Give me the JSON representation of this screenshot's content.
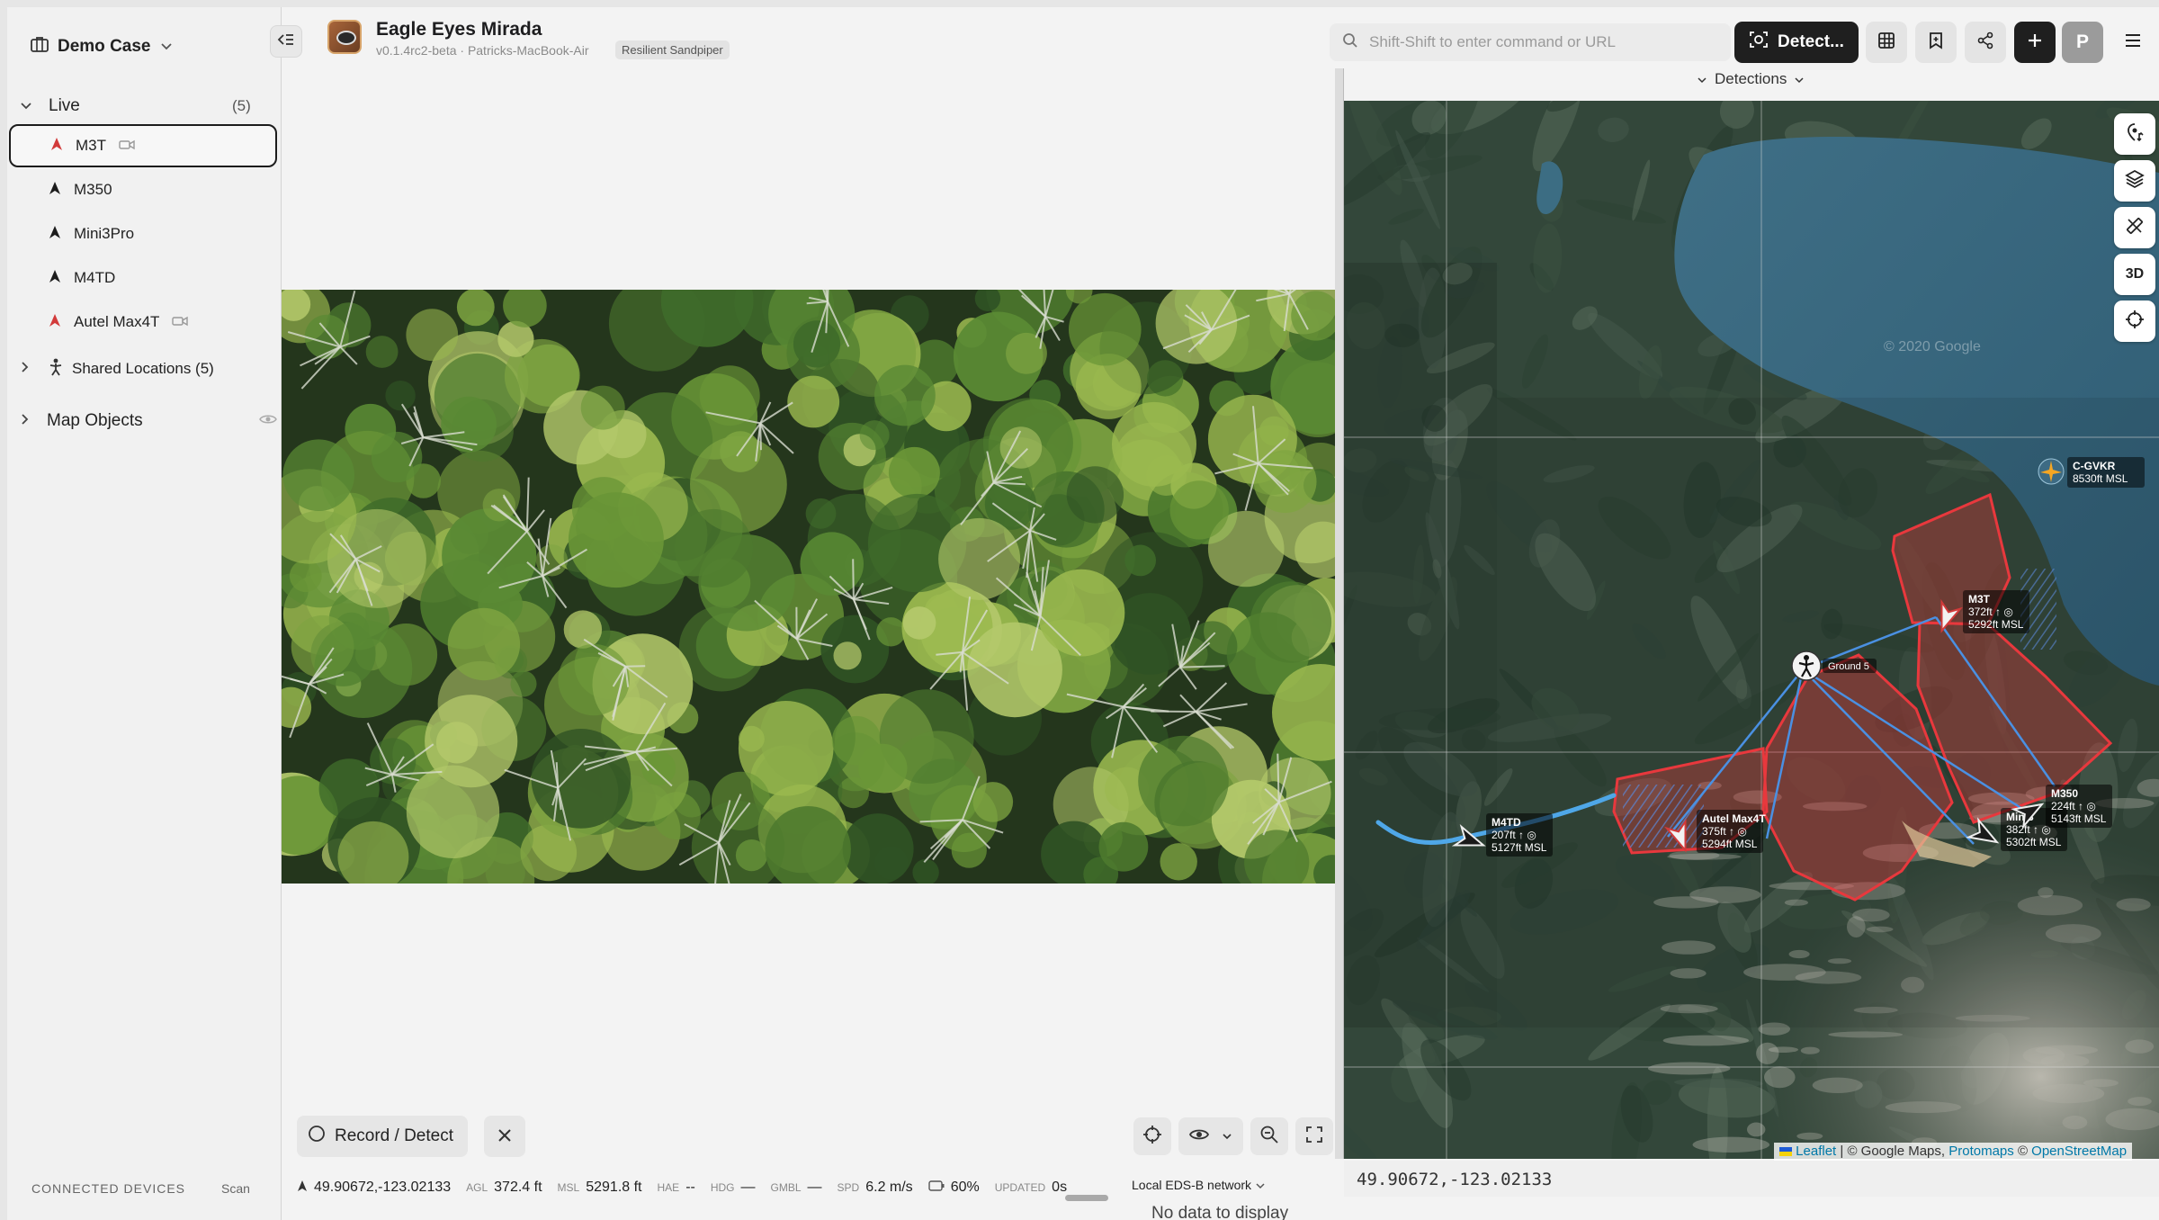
{
  "sidebar": {
    "case_name": "Demo Case",
    "live_label": "Live",
    "live_count": "(5)",
    "devices": [
      {
        "name": "M3T",
        "has_camera": true,
        "arrow_color": "#d23a3a"
      },
      {
        "name": "M350",
        "has_camera": false,
        "arrow_color": "#1c1c1c"
      },
      {
        "name": "Mini3Pro",
        "has_camera": false,
        "arrow_color": "#1c1c1c"
      },
      {
        "name": "M4TD",
        "has_camera": false,
        "arrow_color": "#1c1c1c"
      },
      {
        "name": "Autel Max4T",
        "has_camera": true,
        "arrow_color": "#d23a3a"
      }
    ],
    "shared_locations": "Shared Locations (5)",
    "map_objects": "Map Objects",
    "connected_devices": "CONNECTED DEVICES",
    "scan": "Scan"
  },
  "header": {
    "title": "Eagle Eyes Mirada",
    "subtitle": "v0.1.4rc2-beta · Patricks-MacBook-Air",
    "badge": "Resilient Sandpiper",
    "search_placeholder": "Shift-Shift to enter command or URL",
    "detect_label": "Detect...",
    "avatar_letter": "P"
  },
  "video": {
    "record_label": "Record / Detect"
  },
  "telemetry": {
    "coords": "49.90672,-123.02133",
    "agl_label": "AGL",
    "agl": "372.4 ft",
    "msl_label": "MSL",
    "msl": "5291.8 ft",
    "hae_label": "HAE",
    "hae": "--",
    "hdg_label": "HDG",
    "hdg": "—",
    "gmbl_label": "GMBL",
    "gmbl": "—",
    "spd_label": "SPD",
    "spd": "6.2 m/s",
    "battery": "60%",
    "updated_label": "UPDATED",
    "updated": "0s",
    "network": "Local EDS-B network"
  },
  "bottom": {
    "no_data": "No data to display"
  },
  "map": {
    "detections_label": "Detections",
    "btn_3d": "3D",
    "copyright": "© 2020 Google",
    "aircraft": {
      "name": "C-GVKR",
      "alt": "8530ft MSL"
    },
    "ground_label": "Ground 5",
    "markers": [
      {
        "name": "M3T",
        "l1": "372ft ↑ ◎",
        "l2": "5292ft MSL"
      },
      {
        "name": "M4TD",
        "l1": "207ft ↑ ◎",
        "l2": "5127ft MSL"
      },
      {
        "name": "Autel Max4T",
        "l1": "375ft ↑ ◎",
        "l2": "5294ft MSL"
      },
      {
        "name": "Mini3",
        "l1": "382ft ↑ ◎",
        "l2": "5302ft MSL"
      },
      {
        "name": "M350",
        "l1": "224ft ↑ ◎",
        "l2": "5143ft MSL"
      }
    ],
    "attribution": {
      "leaflet": "Leaflet",
      "sep1": " | © Google Maps, ",
      "protomaps": "Protomaps",
      "sep2": " © ",
      "osm": "OpenStreetMap"
    },
    "cursor_coords": "49.90672,-123.02133"
  },
  "colors": {
    "accent_dark": "#1f1f1f",
    "zone_red": "#e8383d",
    "track_blue": "#4a90e2",
    "aircraft_orange": "#f5a623"
  }
}
